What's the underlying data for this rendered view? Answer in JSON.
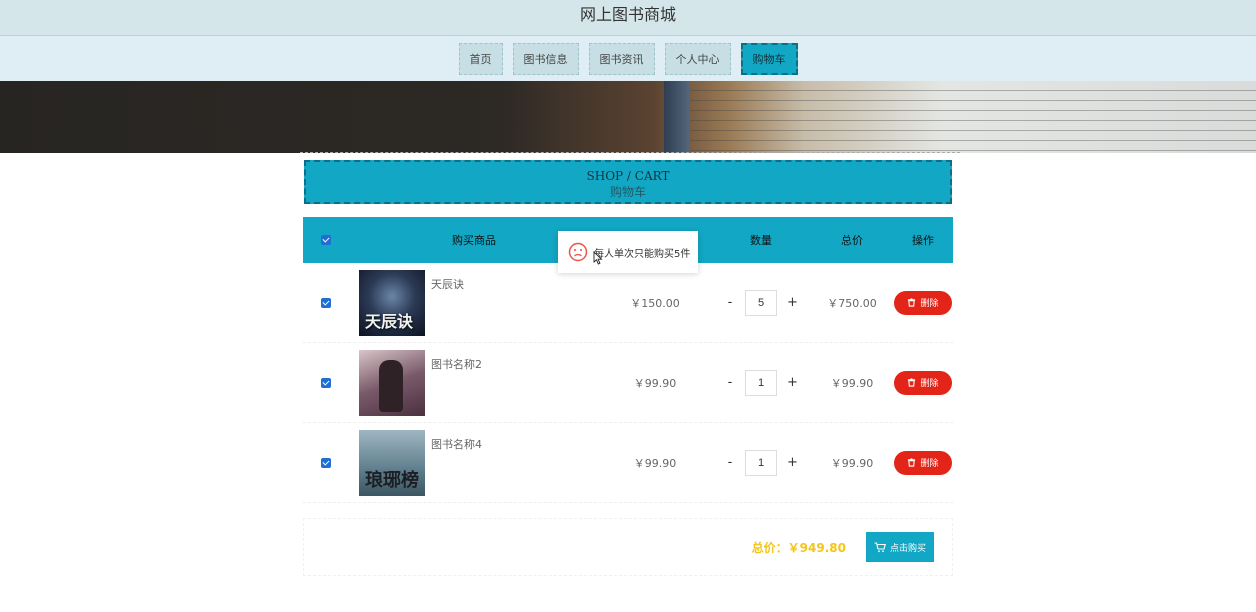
{
  "header": {
    "title": "网上图书商城"
  },
  "nav": {
    "items": [
      {
        "label": "首页"
      },
      {
        "label": "图书信息"
      },
      {
        "label": "图书资讯"
      },
      {
        "label": "个人中心"
      },
      {
        "label": "购物车",
        "active": true
      }
    ]
  },
  "section": {
    "title_en": "SHOP / CART",
    "title_zh": "购物车"
  },
  "cart": {
    "columns": {
      "goods": "购买商品",
      "qty": "数量",
      "total": "总价",
      "op": "操作"
    },
    "select_all_checked": true,
    "items": [
      {
        "name": "天辰诀",
        "cover_text": "天辰诀",
        "price": "￥150.00",
        "qty": "5",
        "total": "￥750.00",
        "checked": true
      },
      {
        "name": "图书名称2",
        "cover_text": "",
        "price": "￥99.90",
        "qty": "1",
        "total": "￥99.90",
        "checked": true
      },
      {
        "name": "图书名称4",
        "cover_text": "琅琊榜",
        "price": "￥99.90",
        "qty": "1",
        "total": "￥99.90",
        "checked": true
      }
    ],
    "minus_label": "-",
    "plus_label": "+",
    "delete_label": "删除"
  },
  "summary": {
    "total_label": "总价：",
    "total_value": "￥949.80",
    "buy_label": "点击购买"
  },
  "toast": {
    "message": "每人单次只能购买5件",
    "icon": "sad-face-icon"
  },
  "colors": {
    "accent": "#12a7c4",
    "danger": "#e32418",
    "total": "#f5c518"
  }
}
